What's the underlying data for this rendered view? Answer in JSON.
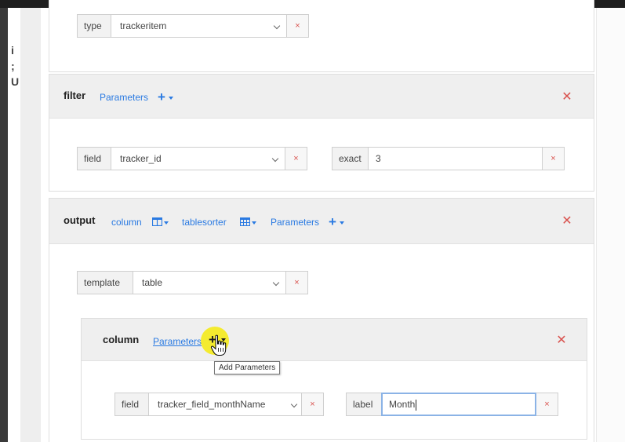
{
  "sidebar": {
    "fragments": [
      "i",
      ";",
      "U"
    ]
  },
  "type_row": {
    "label": "type",
    "value": "trackeritem",
    "remove": "×"
  },
  "filter": {
    "title": "filter",
    "params_link": "Parameters",
    "add_icon": "plus-icon",
    "close": "✕",
    "field": {
      "label": "field",
      "value": "tracker_id",
      "remove": "×"
    },
    "exact": {
      "label": "exact",
      "value": "3",
      "remove": "×"
    }
  },
  "output": {
    "title": "output",
    "column_link": "column",
    "tablesorter_link": "tablesorter",
    "params_link": "Parameters",
    "close": "✕",
    "template": {
      "label": "template",
      "value": "table",
      "remove": "×"
    }
  },
  "column": {
    "title": "column",
    "params_link": "Parameters",
    "tooltip": "Add Parameters",
    "close": "✕",
    "field": {
      "label": "field",
      "value": "tracker_field_monthName",
      "remove": "×"
    },
    "label_field": {
      "label": "label",
      "value": "Month",
      "remove": "×"
    }
  },
  "colors": {
    "accent": "#2a7ae2",
    "danger": "#d9534f",
    "highlight": "#f5eb14",
    "focus": "#8bb3e6"
  }
}
